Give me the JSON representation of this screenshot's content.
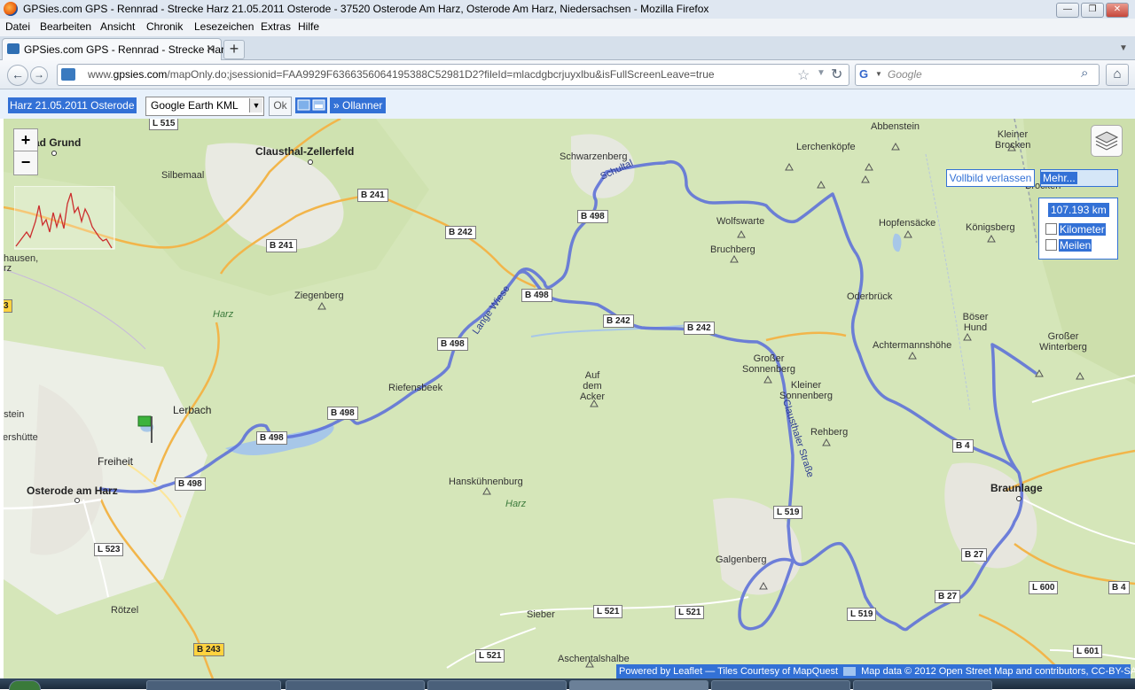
{
  "window": {
    "title": "GPSies.com GPS - Rennrad - Strecke Harz 21.05.2011 Osterode - 37520 Osterode Am Harz, Osterode Am Harz, Niedersachsen - Mozilla Firefox"
  },
  "menu": [
    "Datei",
    "Bearbeiten",
    "Ansicht",
    "Chronik",
    "Lesezeichen",
    "Extras",
    "Hilfe"
  ],
  "tab": {
    "label": "GPSies.com GPS - Rennrad - Strecke Har...",
    "new_tab": "+"
  },
  "nav": {
    "url_prefix": "www.",
    "url_domain": "gpsies.com",
    "url_rest": "/mapOnly.do;jsessionid=FAA9929F6366356064195388C52981D2?fileId=mlacdgbcrjuyxlbu&isFullScreenLeave=true",
    "search_placeholder": "Google"
  },
  "toolbar": {
    "track_name": "Harz 21.05.2011 Osterode",
    "format_value": "Google Earth KML",
    "ok_label": "Ok",
    "ollanner_label": "» Ollanner"
  },
  "map_controls": {
    "zoom_in": "+",
    "zoom_out": "−",
    "fullscreen_leave": "Vollbild verlassen",
    "more": "Mehr...",
    "distance": "107.193 km",
    "unit_km": "Kilometer",
    "unit_miles": "Meilen",
    "attribution_left": "Powered by Leaflet — Tiles Courtesy of MapQuest",
    "attribution_right": "Map data © 2012 Open Street Map and contributors, CC-BY-SA"
  },
  "places": {
    "bad_grund": "ad Grund",
    "clausthal": "Clausthal-Zellerfeld",
    "silbemaal": "Silbemaal",
    "schwarzenberg": "Schwarzenberg",
    "schultal": "Schultal",
    "abbenstein": "Abbenstein",
    "lerchenkoepfe": "Lerchenköpfe",
    "kleiner_brocken": "Kleiner Brocken",
    "brocken": "Brocken",
    "wolfswarte": "Wolfswarte",
    "hopfensaecke": "Hopfensäcke",
    "koenigsberg": "Königsberg",
    "bruchberg": "Bruchberg",
    "ziegenberg": "Ziegenberg",
    "harz1": "Harz",
    "lange_wiese": "Lange Wiese",
    "oderbrueck": "Oderbrück",
    "boeser_hund": "Böser Hund",
    "achtermannshoehe": "Achtermannshöhe",
    "grosser_winterberg": "Großer Winterberg",
    "grosser_sonnenberg": "Großer Sonnenberg",
    "riefensbeek": "Riefensbeek",
    "auf_dem_acker": "Auf dem Acker",
    "kleiner_sonnenberg": "Kleiner Sonnenberg",
    "clausthaler_strasse": "Clausthaler Straße",
    "lerbach": "Lerbach",
    "rehberg": "Rehberg",
    "freiheit": "Freiheit",
    "osterode": "Osterode am Harz",
    "hanskuehnenburg": "Hanskühnenburg",
    "harz2": "Harz",
    "braunlage": "Braunlage",
    "galgenberg": "Galgenberg",
    "roetzel": "Rötzel",
    "sieber": "Sieber",
    "aschentalshalbe": "Aschentalshalbe",
    "stein": "ustein",
    "tershuette": "tershütte",
    "hausen": "hausen,",
    "rz": "rz"
  },
  "roads": {
    "l515": "L 515",
    "b241a": "B 241",
    "b241b": "B 241",
    "b242a": "B 242",
    "b498a": "B 498",
    "b498b": "B 498",
    "b242b": "B 242",
    "b242c": "B 242",
    "b498c": "B 498",
    "b498d": "B 498",
    "b498e": "B 498",
    "b498f": "B 498",
    "b4a": "B 4",
    "l519a": "L 519",
    "b27a": "B 27",
    "b27b": "B 27",
    "l600": "L 600",
    "b4b": "B 4",
    "l523": "L 523",
    "l521a": "L 521",
    "l521b": "L 521",
    "l519b": "L 519",
    "b243": "B 243",
    "l521c": "L 521",
    "l601": "L 601",
    "edge3": "3"
  },
  "colors": {
    "route": "#5f72d8",
    "map_green": "#d5e6b9",
    "selection": "#3371d6"
  }
}
